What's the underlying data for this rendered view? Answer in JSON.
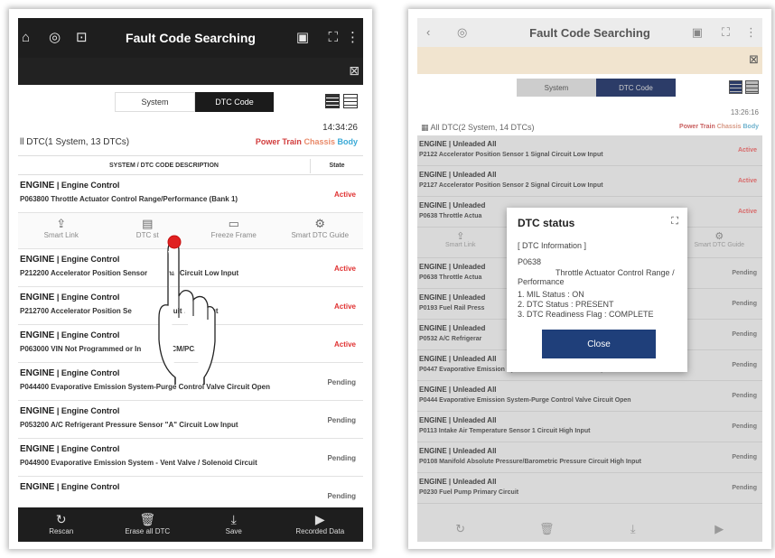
{
  "left": {
    "header": {
      "title": "Fault Code Searching"
    },
    "toggle": {
      "system": "System",
      "dtc": "DTC Code"
    },
    "time": "14:34:26",
    "summary": "ll DTC(1 System, 13 DTCs)",
    "categories": {
      "power_train": "Power Train",
      "chassis": "Chassis",
      "body": "Body"
    },
    "columns": {
      "desc": "SYSTEM / DTC CODE DESCRIPTION",
      "state": "State"
    },
    "rows": [
      {
        "sys": "ENGINE",
        "sub": "Engine Control",
        "desc": "P063800 Throttle Actuator Control Range/Performance (Bank 1)",
        "state": "Active"
      },
      {
        "sys": "ENGINE",
        "sub": "Engine Control",
        "desc": "P212200 Accelerator Position Sensor",
        "desc2": "nal Circuit Low Input",
        "state": "Active"
      },
      {
        "sys": "ENGINE",
        "sub": "Engine Control",
        "desc": "P212700 Accelerator Position Se",
        "desc2": "uit Low Input",
        "state": "Active"
      },
      {
        "sys": "ENGINE",
        "sub": "Engine Control",
        "desc": "P063000 VIN Not Programmed or In",
        "desc2": "r-ECM/PCM",
        "state": "Active"
      },
      {
        "sys": "ENGINE",
        "sub": "Engine Control",
        "desc": "P044400 Evaporative Emission System-Purge Control Valve Circuit Open",
        "state": "Pending"
      },
      {
        "sys": "ENGINE",
        "sub": "Engine Control",
        "desc": "P053200 A/C Refrigerant Pressure Sensor \"A\" Circuit Low Input",
        "state": "Pending"
      },
      {
        "sys": "ENGINE",
        "sub": "Engine Control",
        "desc": "P044900 Evaporative Emission System - Vent Valve / Solenoid Circuit",
        "state": "Pending"
      },
      {
        "sys": "ENGINE",
        "sub": "Engine Control",
        "desc": "",
        "state": "Pending"
      }
    ],
    "actions": [
      {
        "label": "Smart Link",
        "icon": "share-icon"
      },
      {
        "label": "DTC st",
        "icon": "status-icon"
      },
      {
        "label": "Freeze Frame",
        "icon": "freeze-frame-icon"
      },
      {
        "label": "Smart DTC Guide",
        "icon": "gear-icon"
      }
    ],
    "bottom": [
      {
        "label": "Rescan",
        "icon": "refresh-icon"
      },
      {
        "label": "Erase all DTC",
        "icon": "trash-icon"
      },
      {
        "label": "Save",
        "icon": "download-icon"
      },
      {
        "label": "Recorded Data",
        "icon": "recorded-data-icon"
      }
    ]
  },
  "right": {
    "header": {
      "title": "Fault Code Searching"
    },
    "toggle": {
      "system": "System",
      "dtc": "DTC Code"
    },
    "time": "13:26:16",
    "summary": "All DTC(2 System, 14 DTCs)",
    "categories": {
      "power_train": "Power Train",
      "chassis": "Chassis",
      "body": "Body"
    },
    "rows": [
      {
        "sys": "ENGINE | Unleaded All",
        "desc": "P2122 Accelerator Position Sensor 1 Signal Circuit Low Input",
        "state": "Active"
      },
      {
        "sys": "ENGINE | Unleaded All",
        "desc": "P2127 Accelerator Position Sensor 2 Signal Circuit Low Input",
        "state": "Active"
      },
      {
        "sys": "ENGINE | Unleaded",
        "desc": "P0638 Throttle Actua",
        "state": "Active"
      },
      {
        "sys": "ENGINE | Unleaded",
        "desc": "P0638 Throttle Actua",
        "state": "Pending"
      },
      {
        "sys": "ENGINE | Unleaded",
        "desc": "P0193 Fuel Rail Press",
        "state": "Pending"
      },
      {
        "sys": "ENGINE | Unleaded",
        "desc": "P0532 A/C Refrigerar",
        "state": "Pending"
      },
      {
        "sys": "ENGINE | Unleaded All",
        "desc": "P0447 Evaporative Emission System - Vent Control Circuit Open",
        "state": "Pending"
      },
      {
        "sys": "ENGINE | Unleaded All",
        "desc": "P0444 Evaporative Emission System-Purge Control Valve Circuit Open",
        "state": "Pending"
      },
      {
        "sys": "ENGINE | Unleaded All",
        "desc": "P0113 Intake Air Temperature Sensor 1 Circuit High Input",
        "state": "Pending"
      },
      {
        "sys": "ENGINE | Unleaded All",
        "desc": "P0108 Manifold Absolute Pressure/Barometric Pressure Circuit High Input",
        "state": "Pending"
      },
      {
        "sys": "ENGINE | Unleaded All",
        "desc": "P0230 Fuel Pump Primary Circuit",
        "state": "Pending"
      }
    ],
    "actions": [
      {
        "label": "Smart Link"
      },
      {
        "label": "Smart DTC Guide"
      }
    ],
    "modal": {
      "title": "DTC status",
      "section": "[ DTC Information ]",
      "code": "P0638",
      "desc": "Throttle Actuator Control Range / Performance",
      "status_lines": [
        "1. MIL Status : ON",
        "2. DTC Status : PRESENT",
        "3. DTC Readiness Flag : COMPLETE"
      ],
      "close": "Close"
    }
  }
}
